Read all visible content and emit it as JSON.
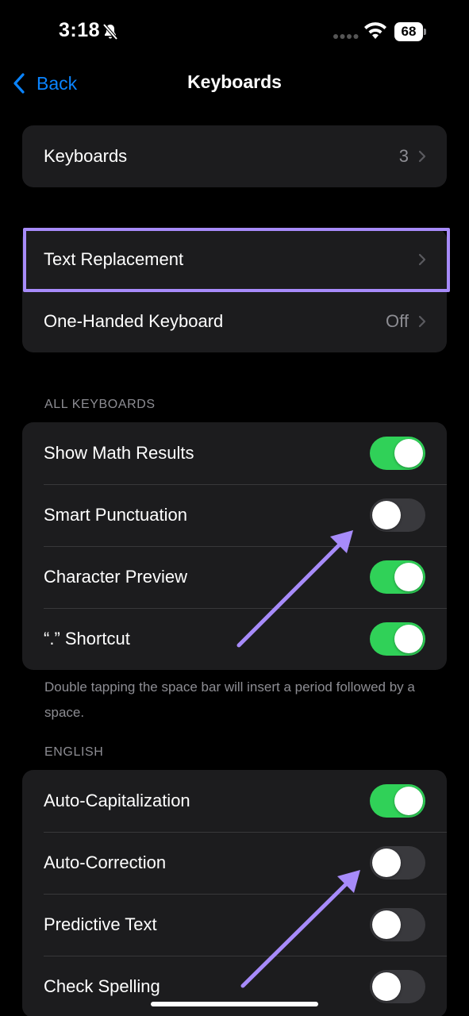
{
  "status_bar": {
    "time": "3:18",
    "battery": "68",
    "icons": [
      "bell-slash-icon",
      "signal-dots-icon",
      "wifi-icon",
      "battery-icon"
    ]
  },
  "nav": {
    "back_label": "Back",
    "title": "Keyboards"
  },
  "groups": {
    "keyboards": {
      "label": "Keyboards",
      "value": "3"
    },
    "text_replacement": {
      "label": "Text Replacement"
    },
    "one_handed": {
      "label": "One-Handed Keyboard",
      "value": "Off"
    }
  },
  "all_keyboards": {
    "header": "ALL KEYBOARDS",
    "items": [
      {
        "label": "Show Math Results",
        "on": true
      },
      {
        "label": "Smart Punctuation",
        "on": false
      },
      {
        "label": "Character Preview",
        "on": true
      },
      {
        "label": "“.” Shortcut",
        "on": true
      }
    ],
    "footer": "Double tapping the space bar will insert a period followed by a space."
  },
  "english": {
    "header": "ENGLISH",
    "items": [
      {
        "label": "Auto-Capitalization",
        "on": true
      },
      {
        "label": "Auto-Correction",
        "on": false
      },
      {
        "label": "Predictive Text",
        "on": false
      },
      {
        "label": "Check Spelling",
        "on": false
      }
    ]
  },
  "colors": {
    "accent": "#0a84ff",
    "toggle_on": "#30d158",
    "highlight": "#a78bfa"
  }
}
